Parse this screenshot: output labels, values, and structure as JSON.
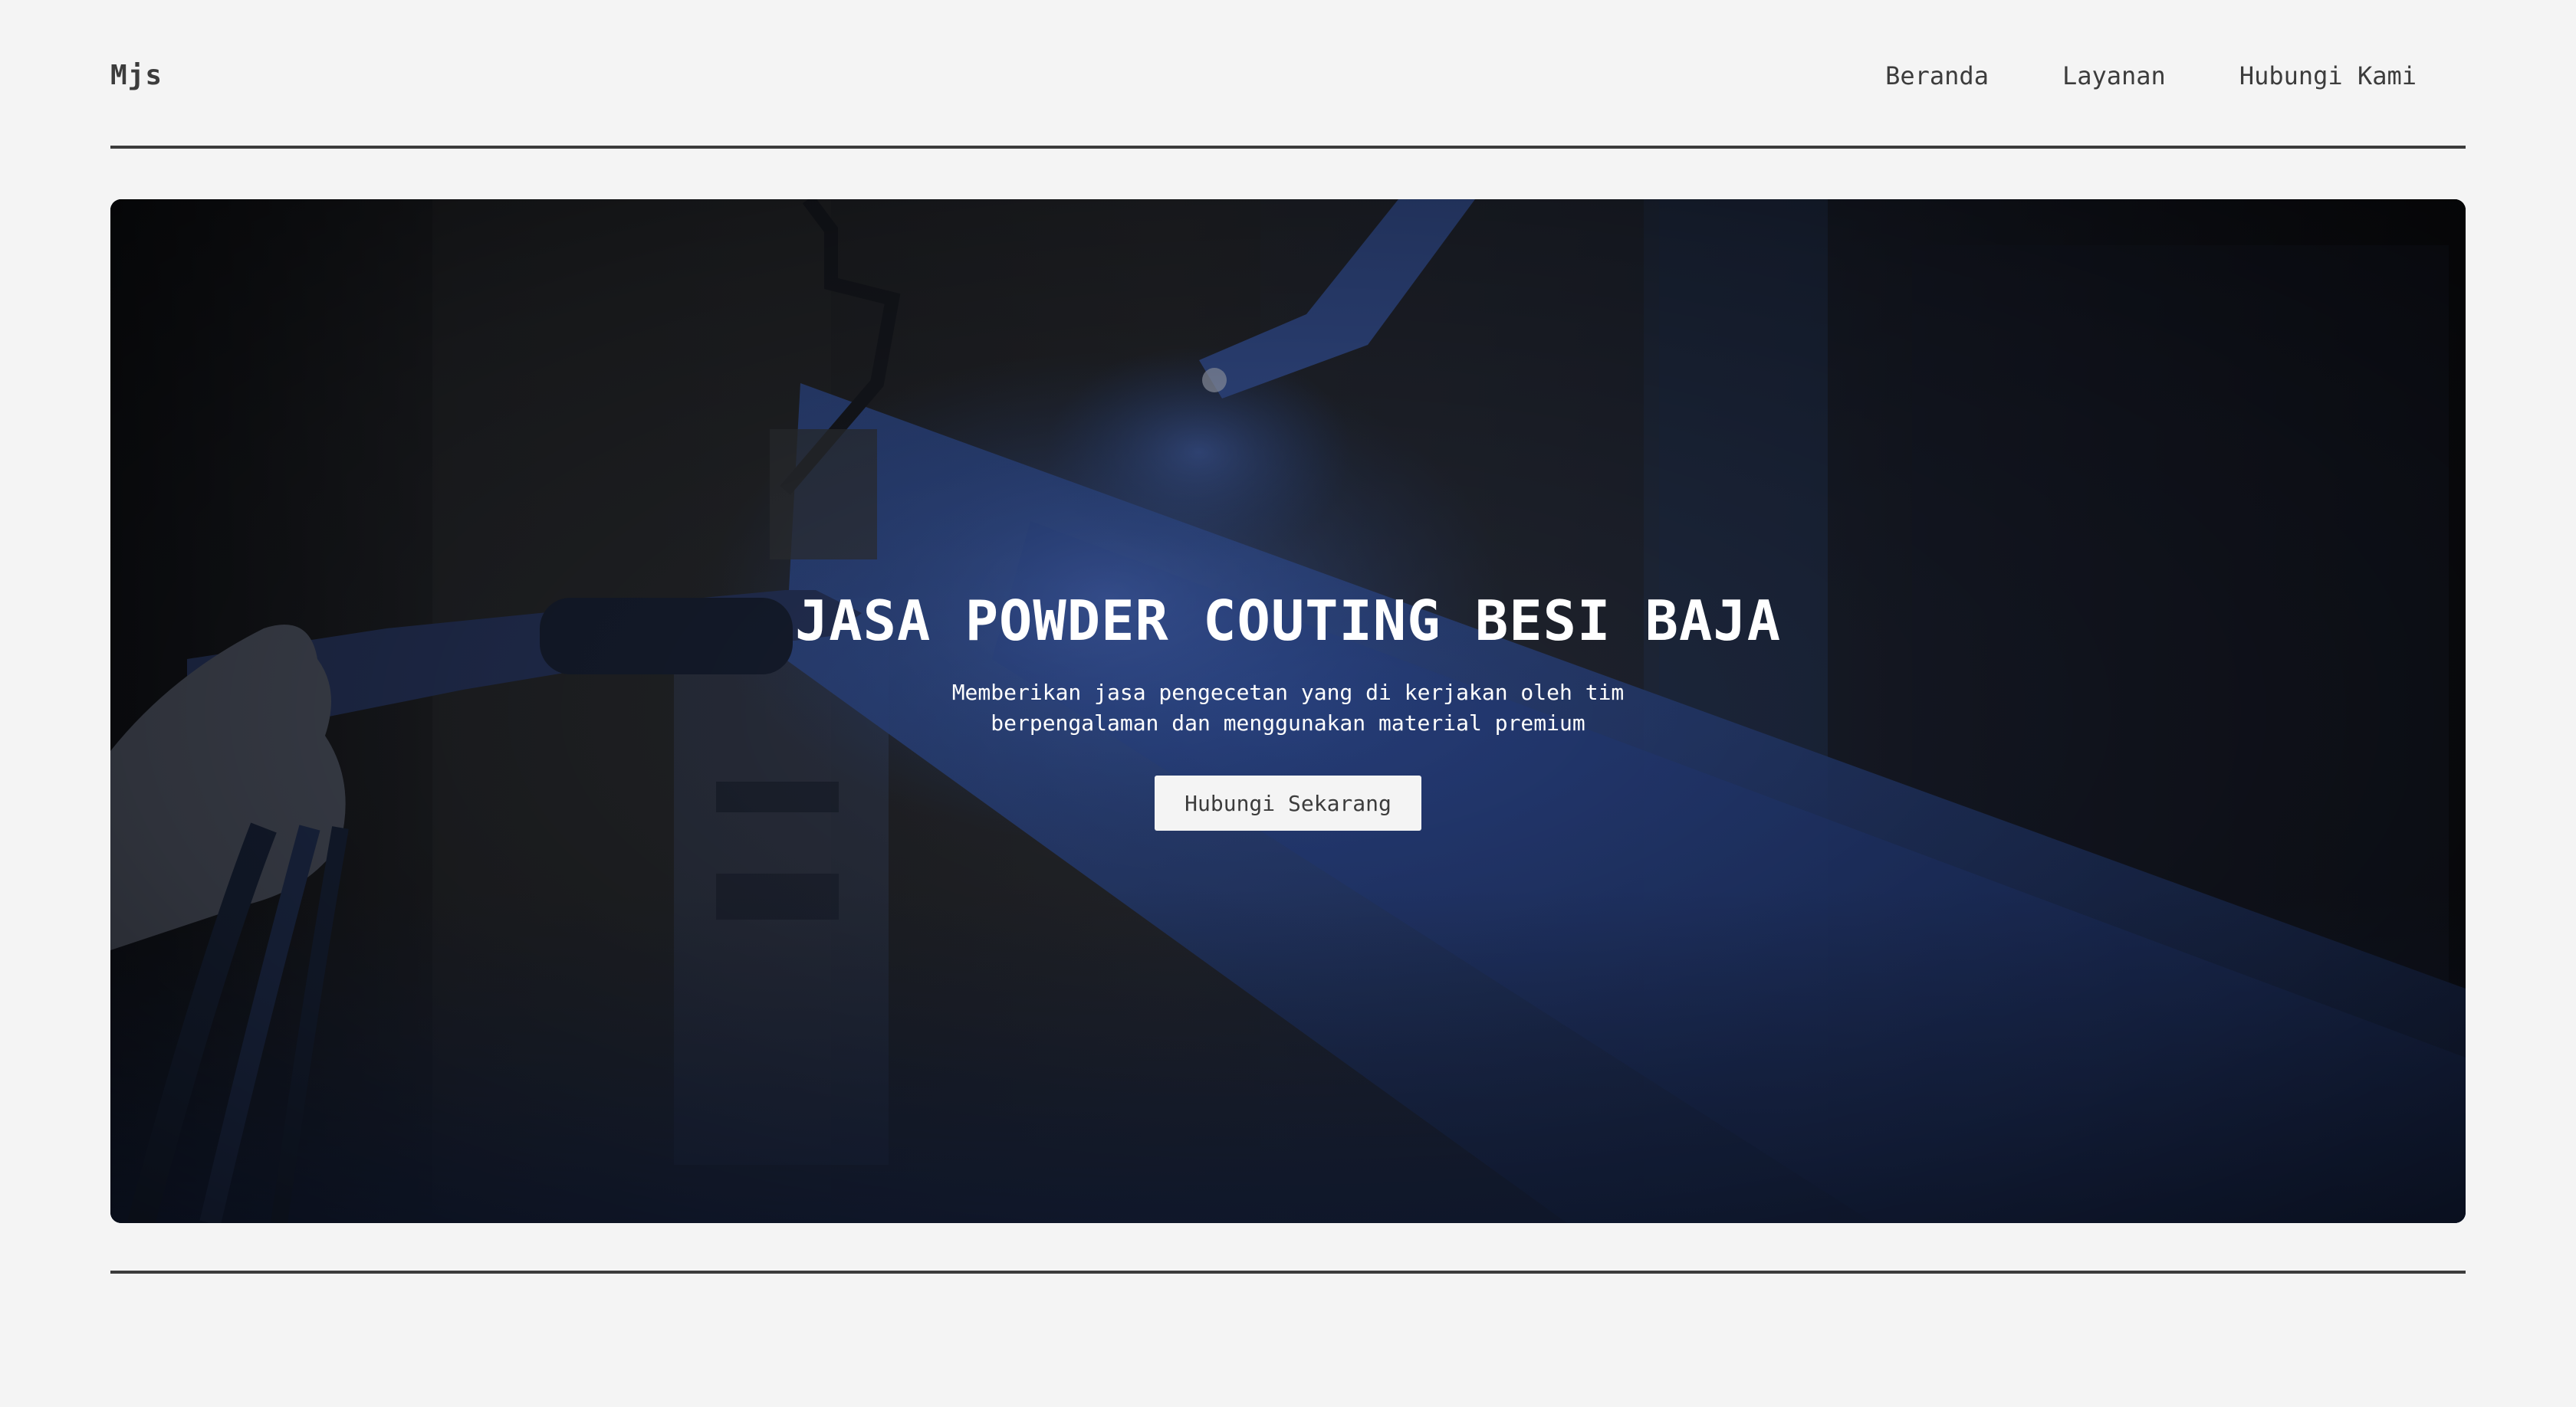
{
  "header": {
    "logo": "Mjs",
    "nav": [
      {
        "label": "Beranda"
      },
      {
        "label": "Layanan"
      },
      {
        "label": "Hubungi Kami"
      }
    ]
  },
  "hero": {
    "title": "JASA POWDER COUTING BESI BAJA",
    "subtitle": "Memberikan jasa pengecetan yang di kerjakan oleh tim berpengalaman dan menggunakan material premium",
    "cta_label": "Hubungi Sekarang",
    "accent_color": "#2a4a8c"
  }
}
